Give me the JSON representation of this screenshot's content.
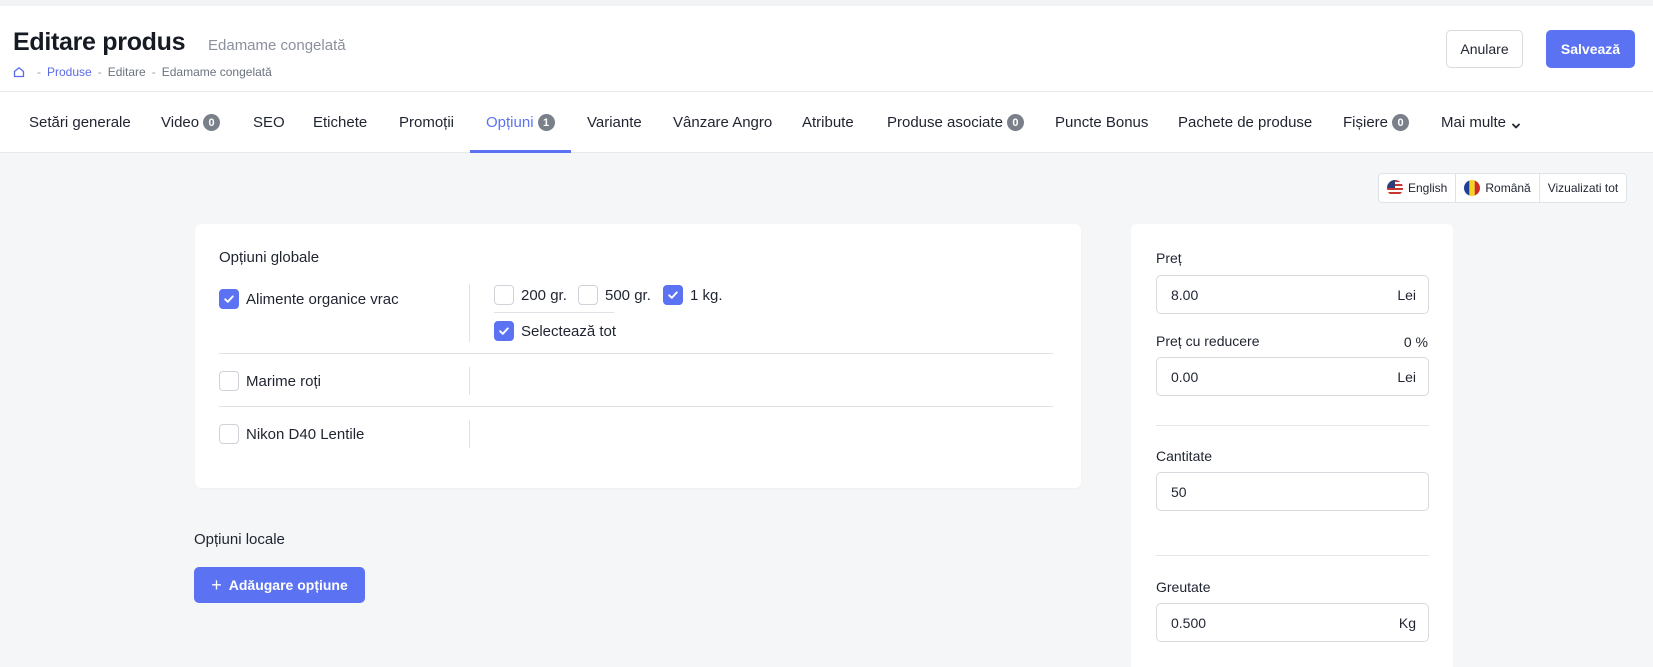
{
  "header": {
    "title": "Editare produs",
    "subtitle": "Edamame congelată",
    "breadcrumb": [
      "Produse",
      "Editare",
      "Edamame congelată"
    ],
    "cancel_label": "Anulare",
    "save_label": "Salvează"
  },
  "tabs": [
    {
      "label": "Setări generale",
      "badge": null
    },
    {
      "label": "Video",
      "badge": "0"
    },
    {
      "label": "SEO",
      "badge": null
    },
    {
      "label": "Etichete",
      "badge": null
    },
    {
      "label": "Promoții",
      "badge": null
    },
    {
      "label": "Opțiuni",
      "badge": "1",
      "active": true
    },
    {
      "label": "Variante",
      "badge": null
    },
    {
      "label": "Vânzare Angro",
      "badge": null
    },
    {
      "label": "Atribute",
      "badge": null
    },
    {
      "label": "Produse asociate",
      "badge": "0"
    },
    {
      "label": "Puncte Bonus",
      "badge": null
    },
    {
      "label": "Pachete de produse",
      "badge": null
    },
    {
      "label": "Fișiere",
      "badge": "0"
    },
    {
      "label": "Mai multe",
      "badge": null
    }
  ],
  "languages": {
    "english": "English",
    "romana": "Română",
    "view_all": "Vizualizati tot"
  },
  "global_options": {
    "title": "Opțiuni globale",
    "groups": [
      {
        "label": "Alimente organice vrac",
        "checked": true,
        "values": [
          {
            "label": "200 gr.",
            "checked": false
          },
          {
            "label": "500 gr.",
            "checked": false
          },
          {
            "label": "1 kg.",
            "checked": true
          }
        ],
        "select_all": {
          "label": "Selectează tot",
          "checked": true
        }
      },
      {
        "label": "Marime roți",
        "checked": false
      },
      {
        "label": "Nikon D40 Lentile",
        "checked": false
      }
    ]
  },
  "local_options": {
    "title": "Opțiuni locale",
    "add_label": "Adăugare opțiune"
  },
  "pricing": {
    "price_label": "Preț",
    "price_value": "8.00",
    "price_unit": "Lei",
    "discount_label": "Preț cu reducere",
    "discount_percent": "0 %",
    "discount_value": "0.00",
    "discount_unit": "Lei",
    "quantity_label": "Cantitate",
    "quantity_value": "50",
    "weight_label": "Greutate",
    "weight_value": "0.500",
    "weight_unit": "Kg"
  },
  "colors": {
    "accent": "#5b72f2",
    "badge": "#7a8089"
  }
}
